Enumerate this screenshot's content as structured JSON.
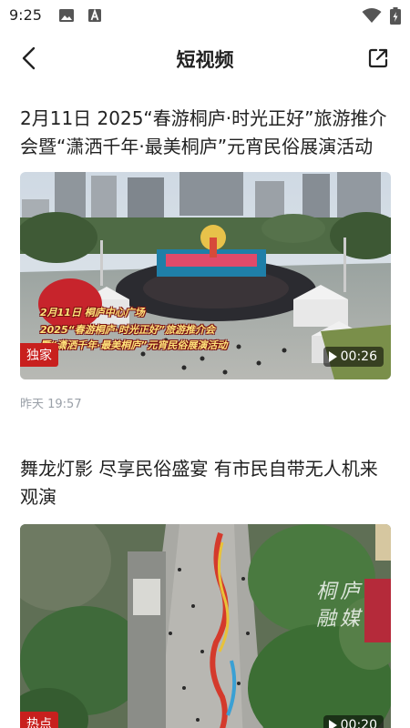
{
  "status_bar": {
    "time": "9:25"
  },
  "header": {
    "title": "短视频"
  },
  "articles": [
    {
      "title": "2月11日 2025“春游桐庐·时光正好”旅游推介会暨“潇洒千年·最美桐庐”元宵民俗展演活动",
      "badge": "独家",
      "duration": "00:26",
      "time": "昨天 19:57",
      "overlay": {
        "line1": "2月11日  桐庐中心广场",
        "line2": "2025“春游桐庐·时光正好”旅游推介会",
        "line3": "暨“潇洒千年·最美桐庐”元宵民俗展演活动"
      }
    },
    {
      "title": "舞龙灯影 尽享民俗盛宴 有市民自带无人机来观演",
      "badge": "热点",
      "duration": "00:20",
      "watermark": "桐庐融媒"
    }
  ],
  "icons": {
    "status": [
      "image-icon",
      "a-letter-icon",
      "wifi-icon",
      "battery-icon"
    ],
    "header": [
      "back-arrow-icon",
      "share-icon"
    ],
    "video": "play-icon"
  },
  "colors": {
    "badge": "#c8201e",
    "time_text": "#9aa0a8",
    "title_text": "#222222"
  }
}
